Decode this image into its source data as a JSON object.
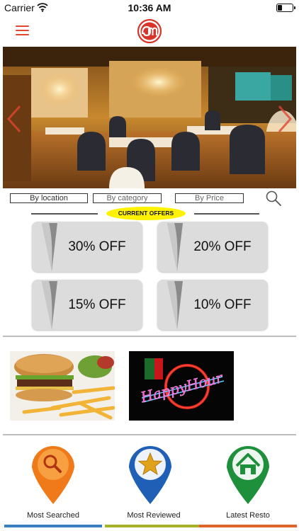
{
  "status_bar": {
    "carrier": "Carrier",
    "time": "10:36 AM",
    "battery_level": 0.25,
    "icons": [
      "wifi-icon",
      "battery-icon"
    ]
  },
  "header": {
    "menu_icon": "hamburger-menu-icon",
    "logo": "om-logo",
    "brand_color": "#e0462d"
  },
  "hero": {
    "image": "restaurant-interior-photo",
    "prev_icon": "chevron-left-icon",
    "next_icon": "chevron-right-icon"
  },
  "filters": {
    "by_location": "By location",
    "by_category": "By category",
    "by_price": "By Price",
    "search_icon": "search-icon"
  },
  "offers": {
    "title": "CURRENT OFFERS",
    "pill_color": "#fff200",
    "items": [
      {
        "label": "30% OFF"
      },
      {
        "label": "20% OFF"
      },
      {
        "label": "15% OFF"
      },
      {
        "label": "10% OFF"
      }
    ]
  },
  "promos": [
    {
      "name": "burger-and-fries-photo"
    },
    {
      "name": "happy-hour-neon-sign",
      "sign_text": "HappyHour"
    }
  ],
  "categories": [
    {
      "label": "Most Searched",
      "icon": "search-icon",
      "color": "#f07a1a",
      "bar_color": "#3a7fc1"
    },
    {
      "label": "Most  Reviewed",
      "icon": "star-icon",
      "color": "#1f5fb5",
      "bar_color": "#a6b327"
    },
    {
      "label": "Latest Resto",
      "icon": "home-icon",
      "color": "#1e8f3a",
      "bar_color": "#e0642a"
    }
  ]
}
